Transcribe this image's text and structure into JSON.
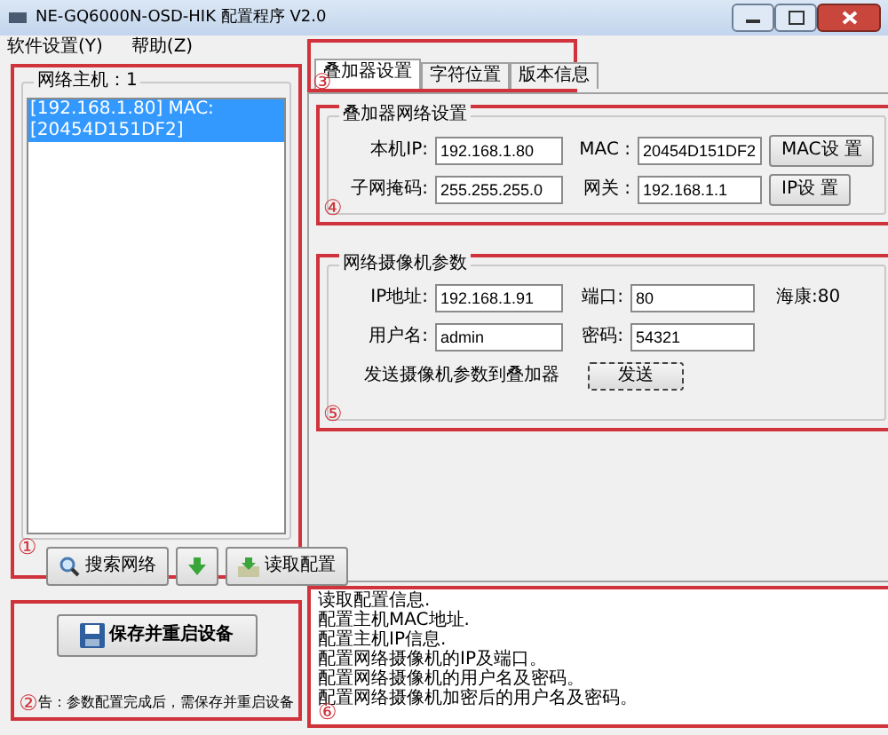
{
  "window": {
    "title": "NE-GQ6000N-OSD-HIK 配置程序 V2.0"
  },
  "menu": [
    "软件设置(Y)",
    "帮助(Z)"
  ],
  "host_panel": {
    "marker": "①",
    "title": "网络主机：1",
    "hosts": [
      {
        "text": "[192.168.1.80] MAC:[20454D151DF2]",
        "selected": true
      }
    ],
    "buttons": [
      {
        "kind": "search",
        "label": "搜索网络"
      },
      {
        "kind": "arrow"
      },
      {
        "kind": "read",
        "label": "读取配置"
      }
    ]
  },
  "save_panel": {
    "marker": "②",
    "button": "保存并重启设备",
    "warning": "告：参数配置完成后，需保存并重启设备"
  },
  "tabs_marker": "③",
  "tabs": [
    {
      "label": "叠加器设置",
      "selected": true
    },
    {
      "label": "字符位置",
      "selected": false
    },
    {
      "label": "版本信息",
      "selected": false
    }
  ],
  "overlay_group": {
    "marker": "④",
    "title": "叠加器网络设置",
    "fields": [
      {
        "label": "本机IP:",
        "value": "192.168.1.80"
      },
      {
        "label": "MAC :",
        "value": "20454D151DF2"
      },
      {
        "label": "子网掩码:",
        "value": "255.255.255.0"
      },
      {
        "label": "网关 :",
        "value": "192.168.1.1"
      }
    ],
    "buttons": [
      "MAC设 置",
      "IP设 置"
    ]
  },
  "camera_group": {
    "marker": "⑤",
    "title": "网络摄像机参数",
    "fields": [
      {
        "label": "IP地址:",
        "value": "192.168.1.91"
      },
      {
        "label": "端口:",
        "value": "80"
      },
      {
        "label": "用户名:",
        "value": "admin"
      },
      {
        "label": "密码:",
        "value": "54321"
      }
    ],
    "note": "海康:80",
    "send_label": "发送摄像机参数到叠加器",
    "send_button": "发送"
  },
  "log": {
    "marker": "⑥",
    "lines": [
      "读取配置信息.",
      "配置主机MAC地址.",
      "配置主机IP信息.",
      "配置网络摄像机的IP及端口。",
      "配置网络摄像机的用户名及密码。",
      "配置网络摄像机加密后的用户名及密码。"
    ]
  }
}
